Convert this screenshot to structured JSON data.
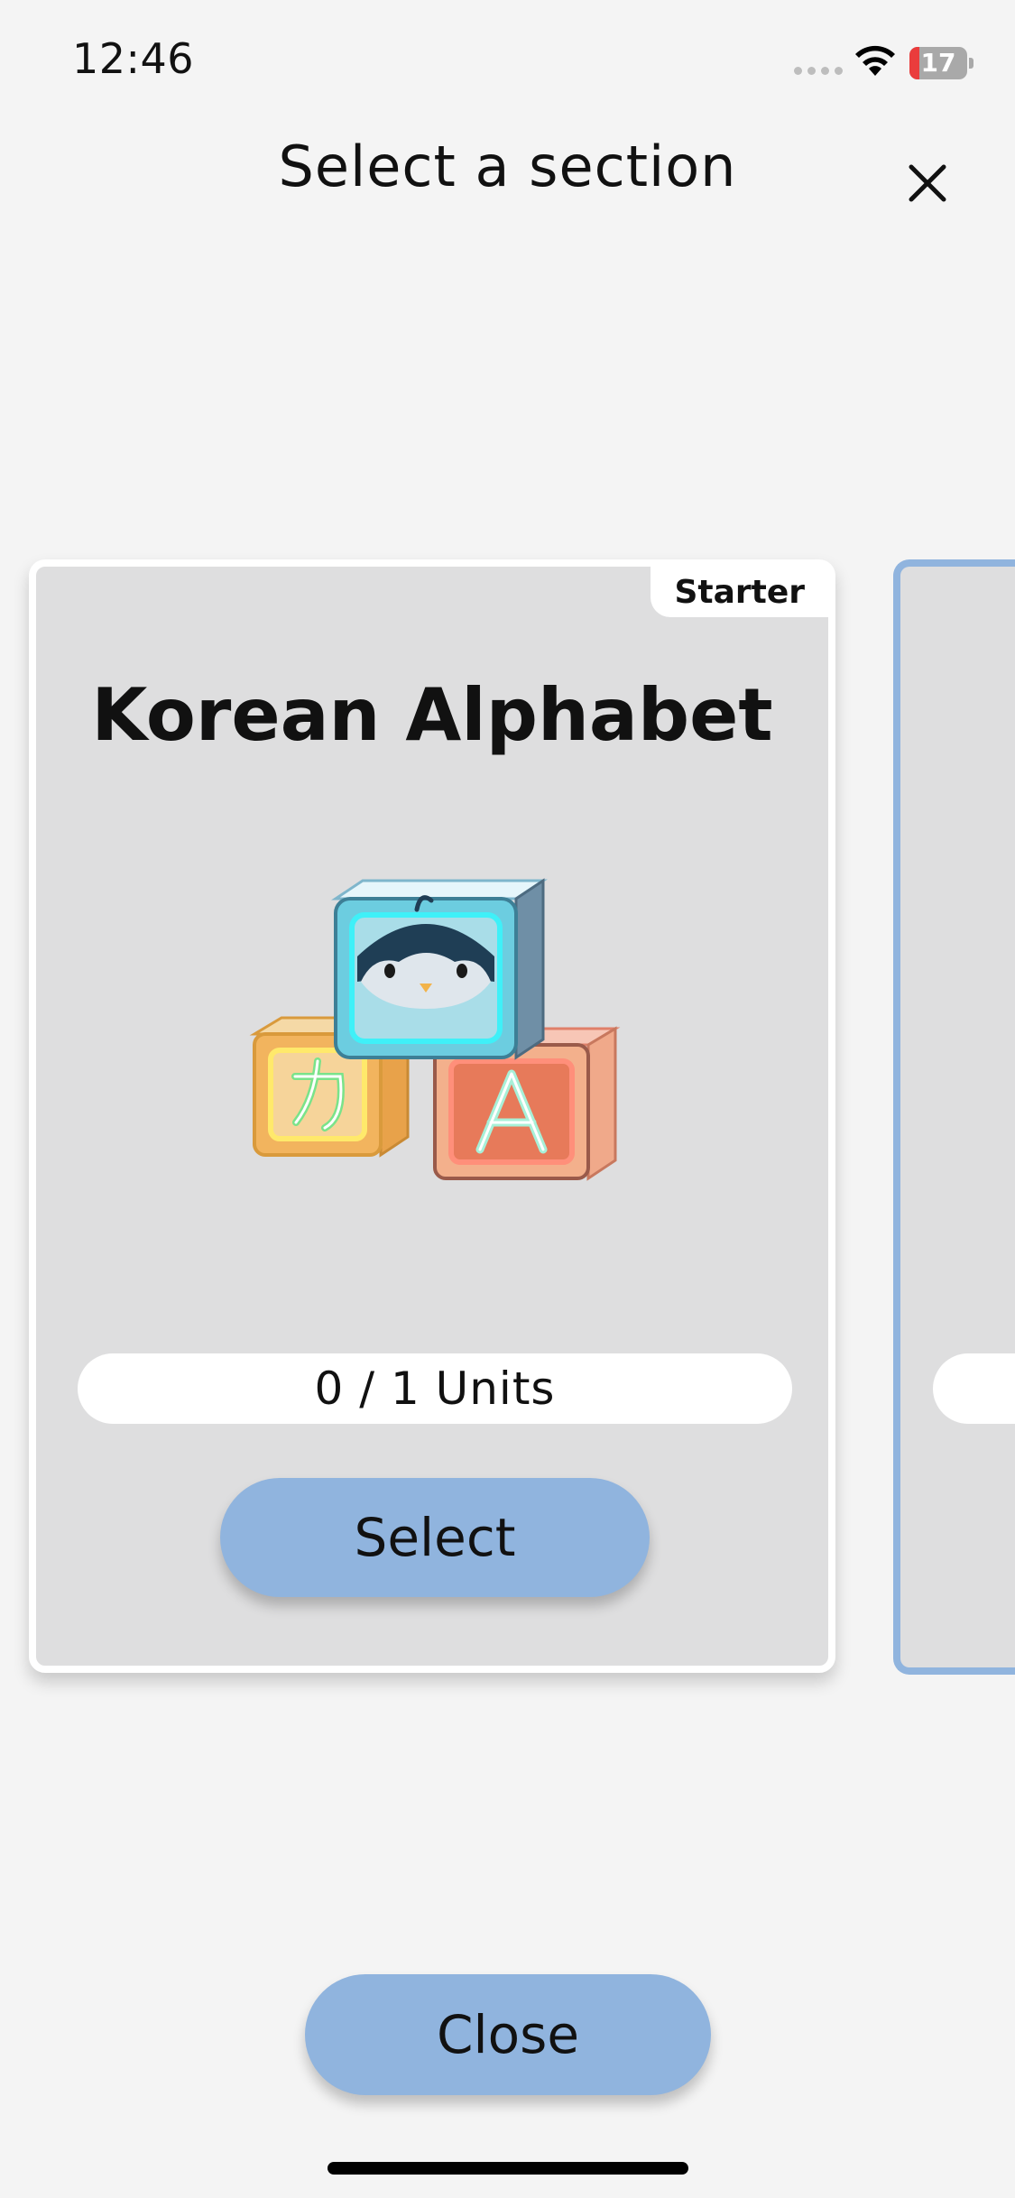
{
  "status_bar": {
    "time": "12:46",
    "battery_level": "17",
    "battery_fraction": 0.17,
    "battery_color": "#ea3c3c"
  },
  "header": {
    "title": "Select a section",
    "close_icon": "close-icon"
  },
  "sections": [
    {
      "badge": "Starter",
      "title": "Korean Alphabet",
      "image": "penguin-alphabet-blocks-illustration",
      "progress": "0 / 1 Units",
      "select_label": "Select"
    }
  ],
  "footer": {
    "close_label": "Close"
  },
  "colors": {
    "accent": "#90b4de",
    "card_background": "#dededf",
    "page_background": "#f4f4f4"
  }
}
